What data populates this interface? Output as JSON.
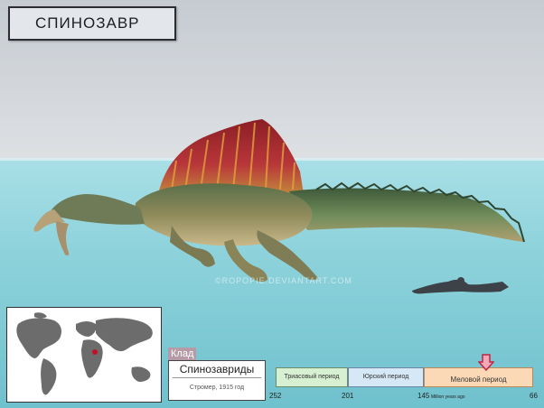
{
  "title": "СПИНОЗАВР",
  "watermark": "©ROPOPIE.DEVIANTART.COM",
  "clade": {
    "tag": "Клад",
    "name": "Спинозавриды",
    "author": "Стромер, 1915 год"
  },
  "timeline": {
    "periods": [
      {
        "name": "Триасовый период",
        "start": 252,
        "end": 201,
        "color": "#d8f0d2"
      },
      {
        "name": "Юрский период",
        "start": 201,
        "end": 145,
        "color": "#d6e8f6"
      },
      {
        "name": "Меловой период",
        "start": 145,
        "end": 66,
        "color": "#fbd9b6"
      }
    ],
    "ticks": [
      "252",
      "201",
      "145",
      "66"
    ],
    "units": "Million years ago",
    "marker_color": "#e8506e"
  },
  "colors": {
    "sail": "#a0282a",
    "water": "#8fd3dc",
    "locator": "#c0102a"
  },
  "icons": {
    "locator": "locator-dot-icon",
    "marker": "arrow-down-icon",
    "scale": "human-swimmer-silhouette-icon"
  }
}
